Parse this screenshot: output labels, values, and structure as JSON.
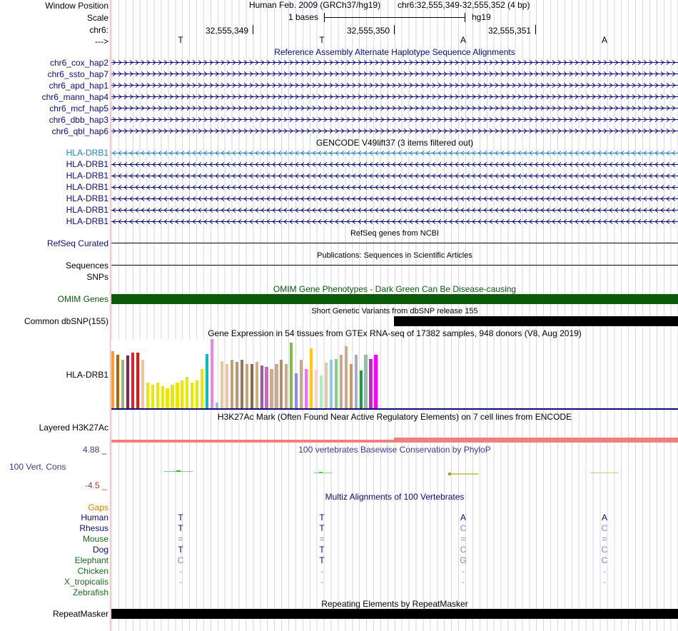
{
  "header": {
    "window_position_label": "Window Position",
    "assembly_text": "Human Feb. 2009 (GRCh37/hg19)",
    "position_text": "chr6:32,555,349-32,555,352 (4 bp)",
    "scale_label": "Scale",
    "scale_text": "1 bases",
    "scale_db": "hg19",
    "chrom_label": "chr6:",
    "arrow_label": "--->",
    "coords": [
      "32,555,349",
      "32,555,350",
      "32,555,351"
    ],
    "bases": [
      "T",
      "T",
      "A",
      "A"
    ]
  },
  "haplotypes": {
    "title": "Reference Assembly Alternate Haplotype Sequence Alignments",
    "items": [
      "chr6_cox_hap2",
      "chr6_ssto_hap7",
      "chr6_apd_hap1",
      "chr6_mann_hap4",
      "chr6_mcf_hap5",
      "chr6_dbb_hap3",
      "chr6_qbl_hap6"
    ]
  },
  "gencode": {
    "title": "GENCODE V49lift37 (3 items filtered out)",
    "items": [
      "HLA-DRB1",
      "HLA-DRB1",
      "HLA-DRB1",
      "HLA-DRB1",
      "HLA-DRB1",
      "HLA-DRB1",
      "HLA-DRB1"
    ],
    "first_color": "#1a84b8",
    "other_color": "#0b0b78"
  },
  "refseq": {
    "title": "RefSeq genes from NCBI",
    "label": "RefSeq Curated"
  },
  "publications": {
    "title": "Publications: Sequences in Scientific Articles",
    "label": "Sequences"
  },
  "snps": {
    "label": "SNPs"
  },
  "omim": {
    "title": "OMIM Gene Phenotypes - Dark Green Can Be Disease-causing",
    "label": "OMIM Genes",
    "color": "#0a5a0a"
  },
  "dbsnp": {
    "title": "Short Genetic Variants from dbSNP release 155",
    "label": "Common dbSNP(155)"
  },
  "gtex": {
    "title": "Gene Expression in 54 tissues from GTEx RNA-seq of 17382 samples, 948 donors (V8, Aug 2019)",
    "label": "HLA-DRB1",
    "values": [
      0.82,
      0.77,
      0.7,
      0.76,
      0.8,
      0.8,
      0.7,
      0.37,
      0.34,
      0.37,
      0.32,
      0.29,
      0.34,
      0.37,
      0.4,
      0.45,
      0.37,
      0.4,
      0.57,
      0.78,
      1.0,
      0.08,
      0.68,
      0.64,
      0.7,
      0.67,
      0.7,
      0.64,
      0.64,
      0.67,
      0.62,
      0.6,
      0.57,
      0.64,
      0.7,
      0.64,
      0.95,
      0.51,
      0.7,
      0.57,
      0.87,
      0.56,
      0.47,
      0.66,
      0.7,
      0.71,
      0.77,
      0.9,
      0.64,
      0.77,
      0.55,
      0.77,
      0.71,
      0.77
    ],
    "colors": [
      "#ff9933",
      "#aa6600",
      "#9bb582",
      "#882255",
      "#dd2222",
      "#ee1111",
      "#e8c8a0",
      "#e8e800",
      "#e8e800",
      "#e8e800",
      "#e8e800",
      "#e8e800",
      "#e8e800",
      "#e8e800",
      "#e8e800",
      "#e8e800",
      "#e8e800",
      "#e8e800",
      "#e8e800",
      "#00c0c0",
      "#ee82ee",
      "#99bbdd",
      "#e8c8a0",
      "#e8c8a0",
      "#c8a070",
      "#bb9977",
      "#997755",
      "#cfa080",
      "#8b6b50",
      "#d0b080",
      "#9e5aa0",
      "#cc66cc",
      "#ccaa88",
      "#ccaa88",
      "#b09070",
      "#ccaa88",
      "#88bb44",
      "#8888ff",
      "#ccaa88",
      "#ff66ff",
      "#ffcc00",
      "#ffcccc",
      "#aaeebb",
      "#e8c8a0",
      "#88ccee",
      "#88cc88",
      "#ccaa88",
      "#ccaa88",
      "#cc9966",
      "#aaaacc",
      "#229944",
      "#99bbaa",
      "#cc22cc",
      "#ff00ff"
    ]
  },
  "h3k27ac": {
    "title": "H3K27Ac Mark (Often Found Near Active Regulatory Elements) on 7 cell lines from ENCODE",
    "label": "Layered H3K27Ac",
    "color": "#f08080"
  },
  "phylop": {
    "title": "100 vertebrates Basewise Conservation by PhyloP",
    "label": "100 Vert. Cons",
    "max": "4.88 _",
    "min": "-4.5 _"
  },
  "multiz": {
    "title": "Multiz Alignments of 100 Vertebrates",
    "gaps_label": "Gaps",
    "species": [
      {
        "name": "Human",
        "bases": [
          "T",
          "T",
          "A",
          "A"
        ]
      },
      {
        "name": "Rhesus",
        "bases": [
          "T",
          "T",
          "C",
          "C"
        ]
      },
      {
        "name": "Mouse",
        "bases": [
          "=",
          "=",
          "=",
          "="
        ]
      },
      {
        "name": "Dog",
        "bases": [
          "T",
          "T",
          "C",
          "C"
        ]
      },
      {
        "name": "Elephant",
        "bases": [
          "C",
          "T",
          "G",
          "C"
        ]
      },
      {
        "name": "Chicken",
        "bases": [
          "-",
          "-",
          "-",
          "-"
        ]
      },
      {
        "name": "X_tropicalis",
        "bases": [
          "-",
          "-",
          "-",
          "-"
        ]
      },
      {
        "name": "Zebrafish",
        "bases": [
          "",
          "",
          "",
          ""
        ]
      }
    ]
  },
  "repeatmasker": {
    "title": "Repeating Elements by RepeatMasker",
    "label": "RepeatMasker"
  }
}
